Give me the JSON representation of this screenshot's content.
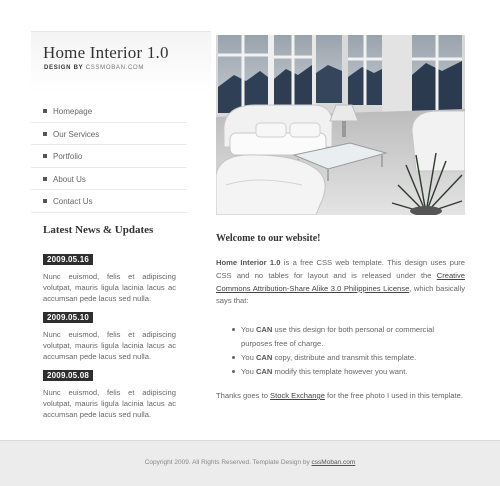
{
  "header": {
    "title": "Home Interior 1.0",
    "subtitle_prefix": "DESIGN BY",
    "subtitle_brand": "CSSMOBAN.COM"
  },
  "nav": {
    "items": [
      {
        "label": "Homepage"
      },
      {
        "label": "Our Services"
      },
      {
        "label": "Portfolio"
      },
      {
        "label": "About Us"
      },
      {
        "label": "Contact Us"
      }
    ]
  },
  "news": {
    "heading": "Latest News & Updates",
    "items": [
      {
        "date": "2009.05.16",
        "text": "Nunc euismod, felis et adipiscing volutpat, mauris ligula lacinia lacus ac accumsan pede lacus sed nulla."
      },
      {
        "date": "2009.05.10",
        "text": "Nunc euismod, felis et adipiscing volutpat, mauris ligula lacinia lacus ac accumsan pede lacus sed nulla."
      },
      {
        "date": "2009.05.08",
        "text": "Nunc euismod, felis et adipiscing volutpat, mauris ligula lacinia lacus ac accumsan pede lacus sed nulla."
      }
    ]
  },
  "main": {
    "heading": "Welcome to our website!",
    "intro_bold": "Home Interior 1.0",
    "intro_text_1": " is a free CSS web template. This design uses pure CSS and no tables for layout and is released under the ",
    "intro_link": "Creative Commons Attribution-Share Alike 3.0 Philippines License",
    "intro_text_2": ", which basically says that:",
    "bullets": [
      {
        "pre": "You ",
        "bold": "CAN",
        "post": " use this design for both personal or commercial purposes free of charge."
      },
      {
        "pre": "You ",
        "bold": "CAN",
        "post": " copy, distribute and transmit this template."
      },
      {
        "pre": "You ",
        "bold": "CAN",
        "post": " modify this template however you want."
      }
    ],
    "thanks_pre": "Thanks goes to ",
    "thanks_link": "Stock Exchange",
    "thanks_post": " for the free photo I used in this template."
  },
  "footer": {
    "text": "Copyright 2009. All Rights Reserved. Template Design by ",
    "link": "cssMoban.com"
  },
  "colors": {
    "date_badge_bg": "#2e2e2e",
    "footer_bg": "#ececec"
  }
}
